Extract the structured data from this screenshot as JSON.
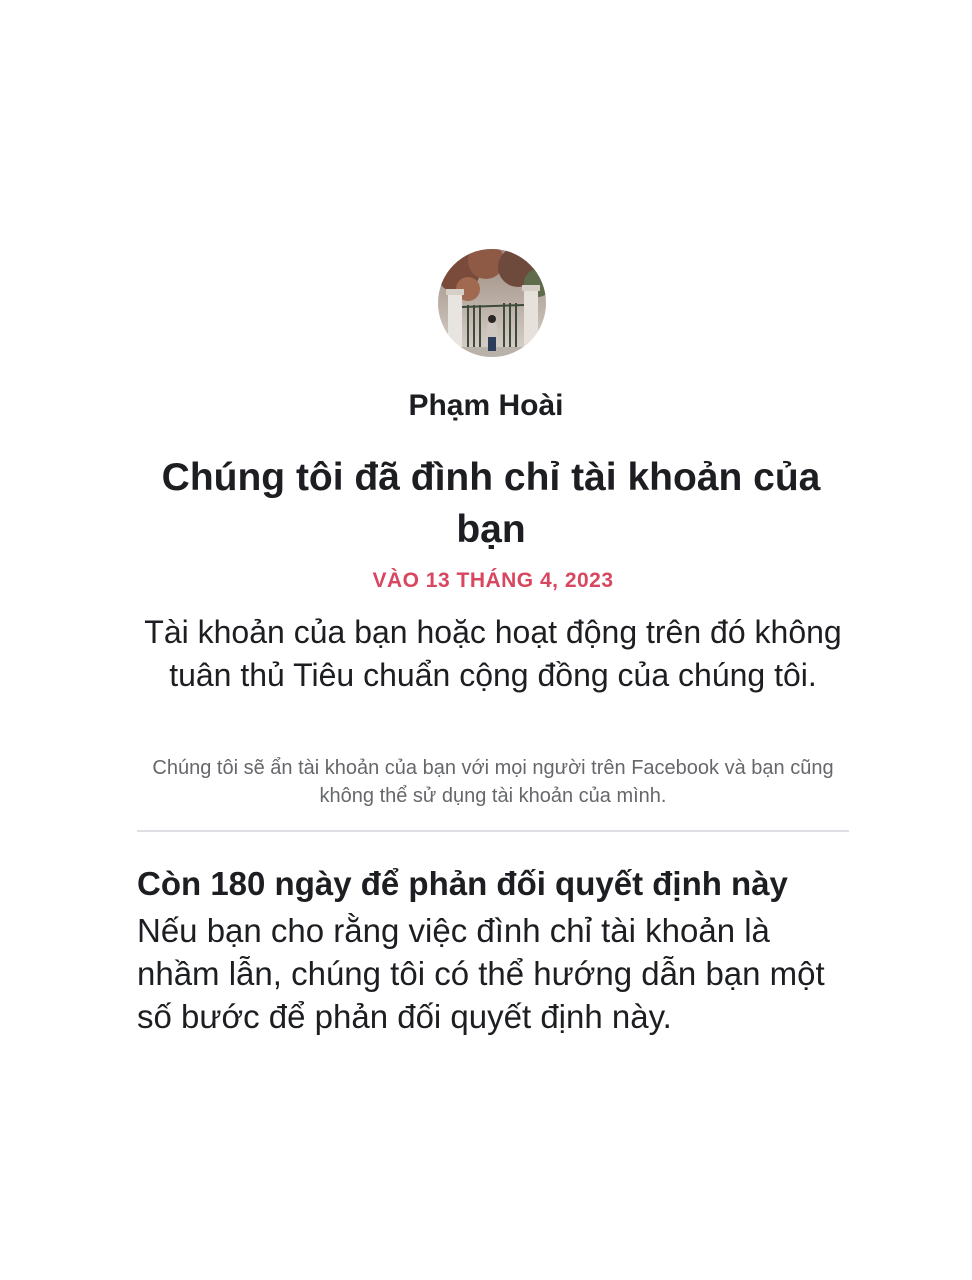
{
  "profile": {
    "name": "Phạm Hoài",
    "avatar_icon": "profile-photo"
  },
  "notice": {
    "title": "Chúng tôi đã đình chỉ tài khoản của bạn",
    "date": "VÀO 13 THÁNG 4, 2023",
    "reason": "Tài khoản của bạn hoặc hoạt động trên đó không tuân thủ Tiêu chuẩn cộng đồng của chúng tôi.",
    "note": "Chúng tôi sẽ ẩn tài khoản của bạn với mọi người trên Facebook và bạn cũng không thể sử dụng tài khoản của mình."
  },
  "appeal": {
    "title": "Còn 180 ngày để phản đối quyết định này",
    "body": "Nếu bạn cho rằng việc đình chỉ tài khoản là nhầm lẫn, chúng tôi có thể hướng dẫn bạn một số bước để phản đối quyết định này."
  },
  "colors": {
    "date_accent": "#d8475f",
    "text_primary": "#1c1e21",
    "text_secondary": "#65676b",
    "divider": "#dddfe2"
  }
}
